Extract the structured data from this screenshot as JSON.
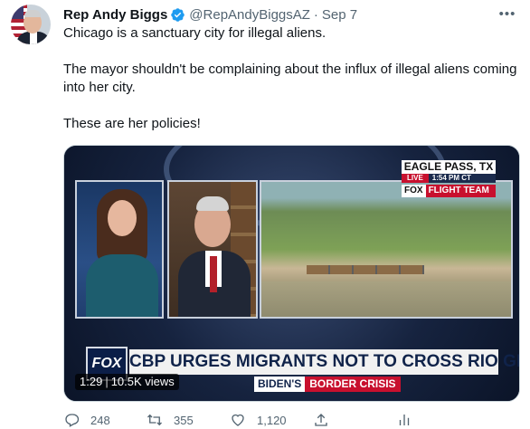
{
  "tweet": {
    "author_name": "Rep Andy Biggs",
    "handle": "@RepAndyBiggsAZ",
    "separator": "·",
    "date": "Sep 7",
    "more_label": "•••",
    "paragraphs": [
      "Chicago is a sanctuary city for illegal aliens.",
      "The mayor shouldn't be complaining about the influx of illegal aliens coming into her city.",
      "These are her policies!"
    ]
  },
  "media": {
    "location": "EAGLE PASS, TX",
    "live_label": "LIVE",
    "time_label": "1:54 PM CT",
    "network_label": "FOX",
    "team_label": "FLIGHT TEAM",
    "logo_text": "FOX",
    "headline": "CBP URGES MIGRANTS NOT TO CROSS RIO GRANDE",
    "lower_third_a": "BIDEN'S",
    "lower_third_b": "BORDER CRISIS",
    "duration": "1:29",
    "stats_sep": "|",
    "views": "10.5K views"
  },
  "actions": {
    "replies": "248",
    "retweets": "355",
    "likes": "1,120"
  },
  "colors": {
    "verified": "#1d9bf0",
    "secondary_text": "#536471",
    "fox_red": "#c8102e",
    "fox_navy": "#10234a"
  },
  "icons": [
    "verified-badge-icon",
    "more-options-icon",
    "reply-icon",
    "retweet-icon",
    "like-icon",
    "share-icon",
    "analytics-icon"
  ]
}
